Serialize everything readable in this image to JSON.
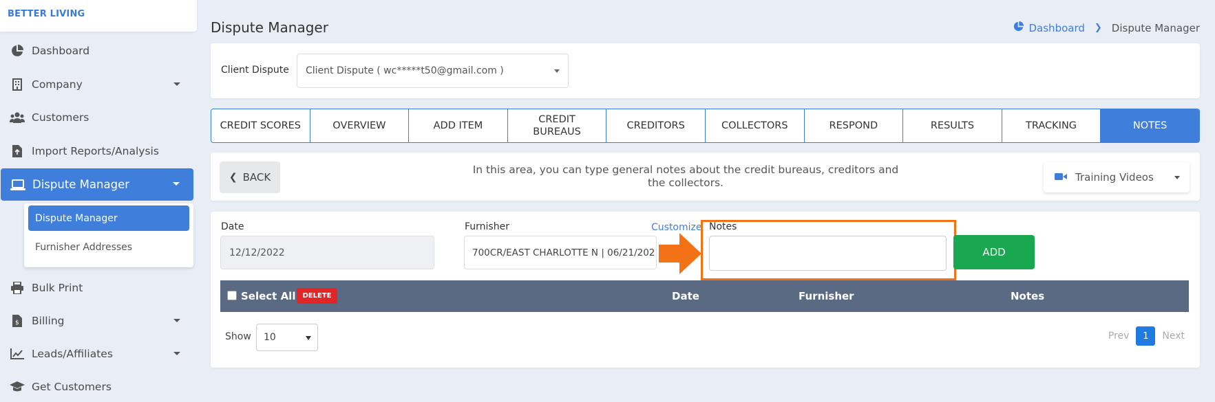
{
  "brand": "BETTER LIVING",
  "sidebar": {
    "items": [
      {
        "label": "Dashboard",
        "icon": "pie-chart-icon"
      },
      {
        "label": "Company",
        "icon": "building-icon"
      },
      {
        "label": "Customers",
        "icon": "users-icon"
      },
      {
        "label": "Import Reports/Analysis",
        "icon": "file-import-icon"
      },
      {
        "label": "Dispute Manager",
        "icon": "laptop-icon"
      },
      {
        "label": "Bulk Print",
        "icon": "printer-icon"
      },
      {
        "label": "Billing",
        "icon": "invoice-icon"
      },
      {
        "label": "Leads/Affiliates",
        "icon": "line-chart-icon"
      },
      {
        "label": "Get Customers",
        "icon": "graduation-cap-icon"
      }
    ],
    "submenu": [
      "Dispute Manager",
      "Furnisher Addresses"
    ]
  },
  "header": {
    "title": "Dispute Manager",
    "breadcrumb_home": "Dashboard",
    "breadcrumb_current": "Dispute Manager"
  },
  "client": {
    "label": "Client Dispute",
    "selected": "Client Dispute ( wc*****t50@gmail.com )"
  },
  "tabs": [
    {
      "label": "CREDIT SCORES"
    },
    {
      "label": "OVERVIEW"
    },
    {
      "label": "ADD ITEM"
    },
    {
      "label": "CREDIT\nBUREAUS"
    },
    {
      "label": "CREDITORS"
    },
    {
      "label": "COLLECTORS"
    },
    {
      "label": "RESPOND"
    },
    {
      "label": "RESULTS"
    },
    {
      "label": "TRACKING"
    },
    {
      "label": "NOTES"
    }
  ],
  "active_tab": "NOTES",
  "info": {
    "back_label": "BACK",
    "text": "In this area, you can type general notes about the credit bureaus, creditors and the collectors.",
    "training_label": "Training Videos"
  },
  "form": {
    "date_label": "Date",
    "date_value": "12/12/2022",
    "furnisher_label": "Furnisher",
    "furnisher_value": "700CR/EAST CHARLOTTE N | 06/21/2021",
    "customize_label": "Customize",
    "notes_label": "Notes",
    "notes_value": "",
    "add_label": "ADD"
  },
  "table": {
    "select_all": "Select All",
    "delete_label": "DELETE",
    "columns": [
      "Date",
      "Furnisher",
      "Notes"
    ]
  },
  "pagination": {
    "show_label": "Show",
    "page_size": "10",
    "prev": "Prev",
    "current": "1",
    "next": "Next"
  },
  "colors": {
    "accent": "#3f7fdb",
    "add_button": "#19a74f",
    "delete_button": "#e02626",
    "highlight": "#f47216",
    "table_header": "#5a6a82"
  }
}
